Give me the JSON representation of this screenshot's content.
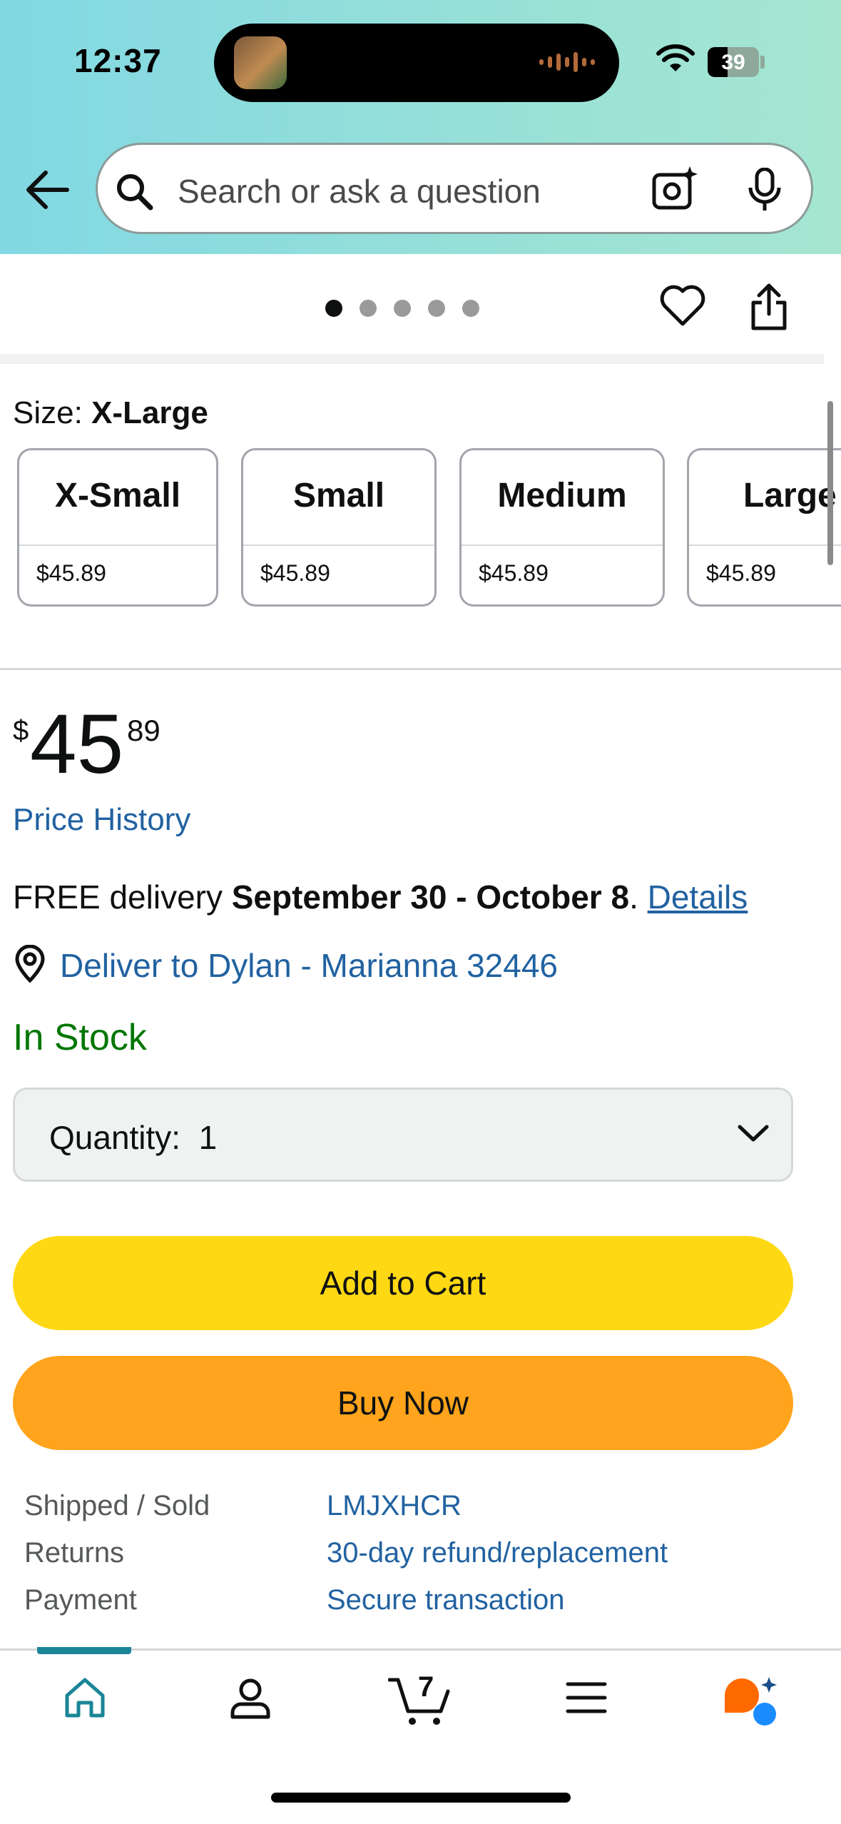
{
  "status_bar": {
    "time": "12:37",
    "battery": "39"
  },
  "search": {
    "placeholder": "Search or ask a question"
  },
  "carousel": {
    "dot_count": 5,
    "active_index": 0
  },
  "size": {
    "label": "Size:",
    "selected": "X-Large",
    "options": [
      {
        "name": "X-Small",
        "price": "$45.89"
      },
      {
        "name": "Small",
        "price": "$45.89"
      },
      {
        "name": "Medium",
        "price": "$45.89"
      },
      {
        "name": "Large",
        "price": "$45.89"
      }
    ]
  },
  "price": {
    "symbol": "$",
    "whole": "45",
    "fraction": "89",
    "history_link": "Price History"
  },
  "delivery": {
    "prefix": "FREE delivery ",
    "dates": "September 30 - October 8",
    "suffix": ". ",
    "details_link": "Details",
    "deliver_to": "Deliver to Dylan - Marianna 32446"
  },
  "stock": {
    "status": "In Stock"
  },
  "quantity": {
    "label": "Quantity:",
    "value": "1"
  },
  "buttons": {
    "add_to_cart": "Add to Cart",
    "buy_now": "Buy Now"
  },
  "info": [
    {
      "label": "Shipped / Sold",
      "value": "LMJXHCR"
    },
    {
      "label": "Returns",
      "value": "30-day refund/replacement"
    },
    {
      "label": "Payment",
      "value": "Secure transaction"
    }
  ],
  "tabbar": {
    "cart_count": "7"
  },
  "colors": {
    "link": "#2162a1",
    "in_stock": "#007600",
    "add_to_cart": "#ffd814",
    "buy_now": "#ffa41c",
    "active_tab": "#1a8598"
  }
}
